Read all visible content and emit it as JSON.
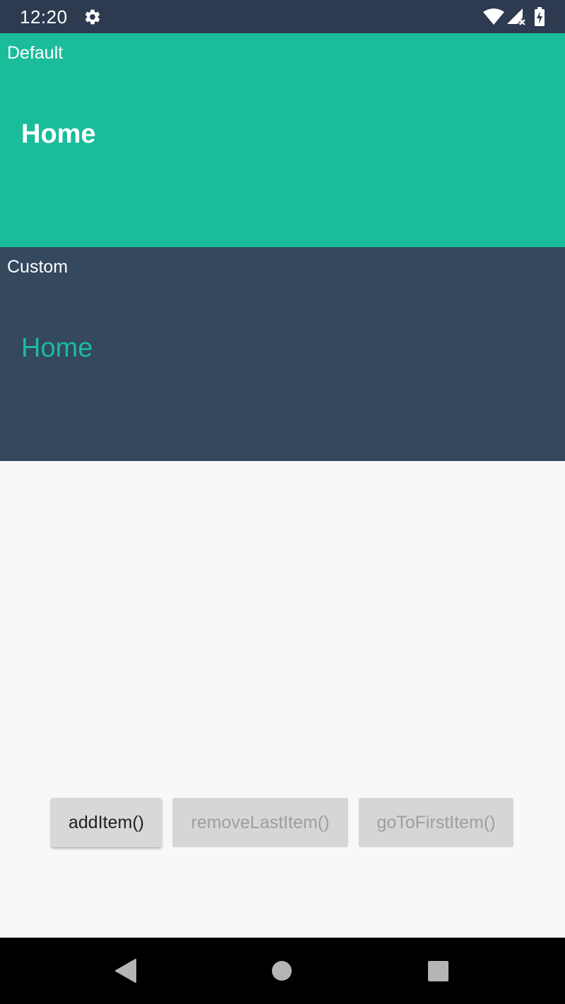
{
  "status_bar": {
    "time": "12:20",
    "icons": [
      "gear-icon",
      "wifi-icon",
      "signal-icon",
      "battery-icon"
    ]
  },
  "sections": [
    {
      "label": "Default",
      "title": "Home",
      "background": "#1abc9c",
      "title_color": "#ffffff"
    },
    {
      "label": "Custom",
      "title": "Home",
      "background": "#34485e",
      "title_color": "#1abc9c"
    }
  ],
  "buttons": {
    "add_item": "addItem()",
    "remove_last_item": "removeLastItem()",
    "go_to_first_item": "goToFirstItem()"
  },
  "nav_bar": {
    "icons": [
      "back-icon",
      "home-icon",
      "recents-icon"
    ]
  },
  "colors": {
    "status_bar": "#2d3a50",
    "accent": "#1abc9c",
    "custom_background": "#34485e",
    "content_background": "#f8f7f9",
    "button_background": "#d6d6d6"
  }
}
